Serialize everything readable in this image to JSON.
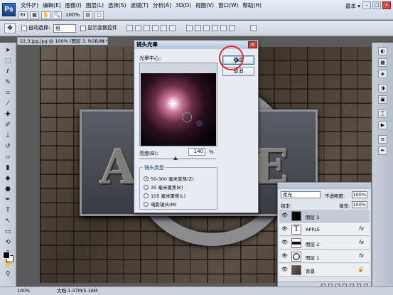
{
  "app": {
    "logo": "Ps",
    "workspace": "基本 ▾",
    "zoom": "100%"
  },
  "menu": [
    "文件(F)",
    "编辑(E)",
    "图像(I)",
    "图层(L)",
    "选择(S)",
    "滤镜(T)",
    "分析(A)",
    "3D(D)",
    "视图(V)",
    "窗口(W)",
    "帮助(H)"
  ],
  "options": {
    "auto_select_label": "自动选择:",
    "auto_select_value": "组",
    "show_transform_label": "显示变换控件"
  },
  "document": {
    "tab_title": "22.3.jpg.jpg @ 100% (图层 3, RGB/8) *",
    "close": "×"
  },
  "canvas": {
    "letters": [
      "A",
      "P",
      "E"
    ]
  },
  "dialog": {
    "title": "镜头光晕",
    "center_label": "光晕中心:",
    "ok": "确定",
    "cancel": "取消",
    "brightness_label": "亮度(B):",
    "brightness_value": "140",
    "brightness_unit": "%",
    "brightness_slider_fraction": 0.47,
    "lens_type_label": "镜头类型",
    "lens_types": [
      "50-300 毫米变焦(Z)",
      "35 毫米聚焦(K)",
      "105 毫米聚焦(L)",
      "电影镜头(M)"
    ],
    "selected_lens_index": 0
  },
  "layers": {
    "blend_mode": "柔光",
    "opacity_label": "不透明度:",
    "opacity": "100%",
    "lock_label": "锁定:",
    "fill_label": "填充:",
    "fill": "100%",
    "items": [
      {
        "name": "图层 3",
        "thumb": "black",
        "fx": "",
        "selected": true
      },
      {
        "name": "APPLE",
        "thumb": "text",
        "fx": "fx",
        "selected": false
      },
      {
        "name": "图层 2",
        "thumb": "shape",
        "fx": "fx",
        "selected": false
      },
      {
        "name": "图层 1",
        "thumb": "ring",
        "fx": "fx",
        "selected": false
      },
      {
        "name": "背景",
        "thumb": "texture",
        "fx": "",
        "selected": false
      }
    ]
  },
  "status": {
    "zoom": "100%",
    "doc_info": "文档:1.37M/5.16M"
  },
  "colors": {
    "highlight_circle": "#e2262d",
    "dialog_close": "#c84438",
    "foreground": "#000000",
    "background": "#ffffff"
  }
}
